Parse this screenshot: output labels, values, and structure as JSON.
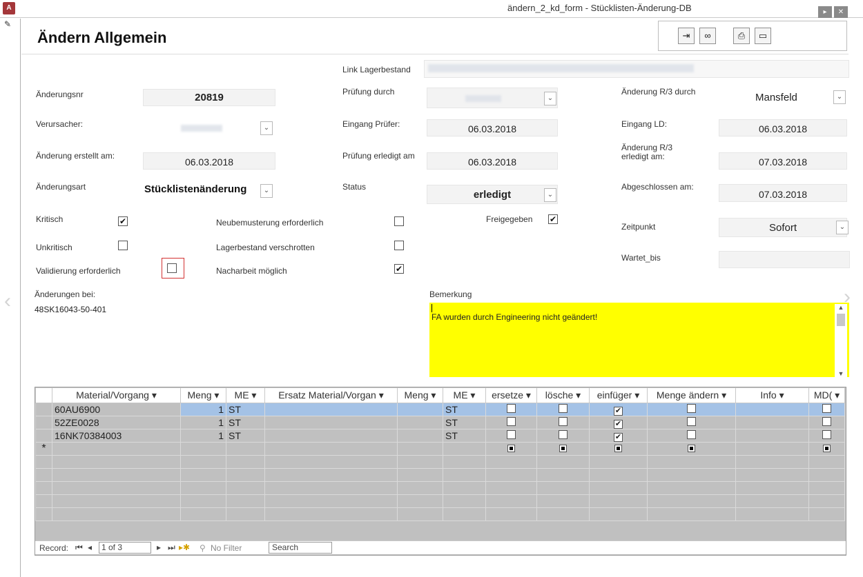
{
  "window": {
    "title": "ändern_2_kd_form - Stücklisten-Änderung-DB",
    "app_icon": "A"
  },
  "header": {
    "title": "Ändern Allgemein"
  },
  "toolbar": {
    "icons": [
      "exit-door-icon",
      "glasses-icon",
      "print-icon",
      "form-icon"
    ]
  },
  "fields": {
    "link_lagerbestand_label": "Link Lagerbestand",
    "aenderungsnr_label": "Änderungsnr",
    "aenderungsnr_value": "20819",
    "verursacher_label": "Verursacher:",
    "aenderung_erstellt_label": "Änderung erstellt am:",
    "aenderung_erstellt_value": "06.03.2018",
    "aenderungsart_label": "Änderungsart",
    "aenderungsart_value": "Stücklistenänderung",
    "pruefung_durch_label": "Prüfung durch",
    "eingang_pruefer_label": "Eingang Prüfer:",
    "eingang_pruefer_value": "06.03.2018",
    "pruefung_erledigt_label": "Prüfung erledigt am",
    "pruefung_erledigt_value": "06.03.2018",
    "status_label": "Status",
    "status_value": "erledigt",
    "aenderung_r3_durch_label": "Änderung R/3 durch",
    "aenderung_r3_durch_value": "Mansfeld",
    "eingang_ld_label": "Eingang LD:",
    "eingang_ld_value": "06.03.2018",
    "aenderung_r3_erledigt_label_1": "Änderung R/3",
    "aenderung_r3_erledigt_label_2": "erledigt am:",
    "aenderung_r3_erledigt_value": "07.03.2018",
    "abgeschlossen_label": "Abgeschlossen am:",
    "abgeschlossen_value": "07.03.2018",
    "zeitpunkt_label": "Zeitpunkt",
    "zeitpunkt_value": "Sofort",
    "wartet_bis_label": "Wartet_bis"
  },
  "checkboxes": {
    "kritisch": {
      "label": "Kritisch",
      "checked": true
    },
    "unkritisch": {
      "label": "Unkritisch",
      "checked": false
    },
    "validierung": {
      "label": "Validierung erforderlich",
      "checked": false
    },
    "neubemusterung": {
      "label": "Neubemusterung erforderlich",
      "checked": false
    },
    "lagerbestand_verschrotten": {
      "label": "Lagerbestand verschrotten",
      "checked": false
    },
    "nacharbeit": {
      "label": "Nacharbeit möglich",
      "checked": true
    },
    "freigegeben": {
      "label": "Freigegeben",
      "checked": true
    }
  },
  "aenderungen_bei": {
    "label": "Änderungen bei:",
    "value": "48SK16043-50-401"
  },
  "bemerkung": {
    "label": "Bemerkung",
    "value": "FA wurden durch Engineering nicht geändert!"
  },
  "datasheet": {
    "columns": [
      "Material/Vorgang",
      "Meng",
      "ME",
      "Ersatz Material/Vorgan",
      "Meng",
      "ME",
      "ersetze",
      "lösche",
      "einfüger",
      "Menge ändern",
      "Info",
      "MD("
    ],
    "rows": [
      {
        "material": "60AU6900",
        "meng": "1",
        "me": "ST",
        "ersatz": "",
        "meng2": "",
        "me2": "ST",
        "ersetze": false,
        "loesche": false,
        "einfueger": true,
        "menge_aendern": false,
        "info": "",
        "md": false
      },
      {
        "material": "52ZE0028",
        "meng": "1",
        "me": "ST",
        "ersatz": "",
        "meng2": "",
        "me2": "ST",
        "ersetze": false,
        "loesche": false,
        "einfueger": true,
        "menge_aendern": false,
        "info": "",
        "md": false
      },
      {
        "material": "16NK70384003",
        "meng": "1",
        "me": "ST",
        "ersatz": "",
        "meng2": "",
        "me2": "ST",
        "ersetze": false,
        "loesche": false,
        "einfueger": true,
        "menge_aendern": false,
        "info": "",
        "md": false
      }
    ],
    "new_row_marker": "*"
  },
  "navigation": {
    "record_label": "Record:",
    "position": "1 of 3",
    "filter_label": "No Filter",
    "search_label": "Search"
  }
}
